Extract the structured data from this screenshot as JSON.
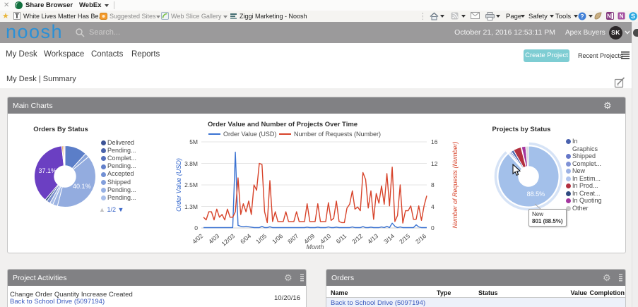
{
  "browser": {
    "webex_bar": {
      "close_icon": "close-icon",
      "share_label": "Share Browser",
      "menu_label": "WebEx"
    },
    "favorites": [
      {
        "icon": "page-favicon",
        "label": "White Lives Matter Has Be..."
      },
      {
        "icon": "suggested-sites-icon",
        "label": "Suggested Sites",
        "dropdown": true
      },
      {
        "icon": "web-slice-icon",
        "label": "Web Slice Gallery",
        "dropdown": true
      },
      {
        "icon": "noosh-favicon",
        "label": "Ziggi Marketing - Noosh"
      }
    ],
    "commands": [
      {
        "icon": "home-icon",
        "dropdown": true
      },
      {
        "icon": "feeds-icon",
        "dropdown": true
      },
      {
        "icon": "mail-icon"
      },
      {
        "icon": "print-icon",
        "dropdown": true
      },
      {
        "label": "Page",
        "dropdown": true
      },
      {
        "label": "Safety",
        "dropdown": true
      },
      {
        "label": "Tools",
        "dropdown": true
      },
      {
        "icon": "help-icon",
        "dropdown": true
      },
      {
        "icon": "notes-app-icon"
      },
      {
        "icon": "onenote-icon"
      },
      {
        "icon": "send-to-onenote-icon"
      },
      {
        "icon": "skype-icon"
      }
    ]
  },
  "header": {
    "logo": "noosh",
    "search_placeholder": "Search...",
    "datetime": "October 21, 2016 12:53:11 PM",
    "account": "Apex Buyers",
    "avatar_initials": "SK"
  },
  "nav": {
    "items": [
      "My Desk",
      "Workspace",
      "Contacts",
      "Reports"
    ],
    "create_button": "Create Project",
    "recent_label": "Recent Projects"
  },
  "breadcrumb": "My Desk | Summary",
  "panels": {
    "main": {
      "title": "Main Charts"
    },
    "activities": {
      "title": "Project Activities",
      "rows": [
        {
          "text": "Change Order Quantity Increase Created",
          "link": "Back to School Drive (5097194)",
          "date": "10/20/16"
        }
      ]
    },
    "orders": {
      "title": "Orders",
      "columns": [
        "Name",
        "Type",
        "Status",
        "Value",
        "Completion"
      ],
      "rows": [
        {
          "name": "Back to School Drive (5097194)",
          "type": "",
          "status": "",
          "value": "",
          "completion": ""
        }
      ]
    }
  },
  "chart_data": [
    {
      "type": "pie",
      "title": "Orders By Status",
      "pie_hole": 0.35,
      "slices": [
        {
          "label": "slice",
          "pct": 11.7,
          "color": "#5b7ec8"
        },
        {
          "label": "slice",
          "pct": 2.2,
          "color": "#8aa5db"
        },
        {
          "label": "slice",
          "pct": 40.1,
          "color": "#93acdf",
          "pct_label": "40.1%"
        },
        {
          "label": "slice",
          "pct": 2.5,
          "color": "#9db4e2"
        },
        {
          "label": "slice",
          "pct": 1.7,
          "color": "#a9bde6"
        },
        {
          "label": "slice",
          "pct": 1.9,
          "color": "#7a90cc"
        },
        {
          "label": "slice",
          "pct": 1.1,
          "color": "#2e4a80"
        },
        {
          "label": "slice",
          "pct": 37.1,
          "color": "#6b3fc2",
          "pct_label": "37.1%"
        },
        {
          "label": "slice",
          "pct": 0.7,
          "color": "#e0a33f"
        },
        {
          "label": "slice",
          "pct": 0.6,
          "color": "#c24040"
        },
        {
          "label": "slice",
          "pct": 0.4,
          "color": "#4a67b0"
        }
      ],
      "legend": {
        "items": [
          {
            "label": "Delivered",
            "color": "#3d5496"
          },
          {
            "label": "Pending...",
            "color": "#4a63ab"
          },
          {
            "label": "Complet...",
            "color": "#5570bc"
          },
          {
            "label": "Pending...",
            "color": "#6380ca"
          },
          {
            "label": "Accepted",
            "color": "#7290d4"
          },
          {
            "label": "Shipped",
            "color": "#84a0dc"
          },
          {
            "label": "Pending...",
            "color": "#97b1e4"
          },
          {
            "label": "Pending...",
            "color": "#a9bfea"
          }
        ],
        "pager": "1/2"
      }
    },
    {
      "type": "line",
      "title": "Order Value and Number of Projects Over Time",
      "xlabel": "Month",
      "x_ticks": [
        "4/02",
        "4/03",
        "12/03",
        "6/04",
        "1/05",
        "1/06",
        "8/07",
        "4/09",
        "4/10",
        "6/11",
        "2/12",
        "4/13",
        "3/14",
        "2/15",
        "2/16"
      ],
      "tick_every": 6,
      "left_axis": {
        "title": "Order Value (USD)",
        "color": "#3366cc",
        "ticks": [
          "0",
          "1.3M",
          "2.5M",
          "3.8M",
          "5M"
        ],
        "max": 5
      },
      "right_axis": {
        "title": "Number of Requests (Number)",
        "color": "#d7432a",
        "ticks": [
          "0",
          "4",
          "8",
          "12",
          "16"
        ],
        "max": 16
      },
      "series": [
        {
          "name": "Order Value (USD)",
          "color": "#3b73d2",
          "axis": "left",
          "values": [
            0.02,
            0.02,
            0.02,
            0.02,
            0.02,
            0.02,
            0.02,
            0.02,
            0.02,
            0.02,
            0.02,
            0.02,
            4.4,
            0.15,
            0.1,
            0.07,
            0.1,
            0.07,
            0.05,
            0.02,
            0.02,
            0.02,
            0.1,
            0.02,
            0.02,
            0.07,
            0.02,
            0.02,
            0.02,
            0.02,
            0.02,
            0.02,
            0.02,
            0.02,
            0.02,
            0.02,
            0.02,
            0.02,
            0.02,
            0.05,
            0.02,
            0.02,
            0.02,
            0.05,
            0.02,
            0.02,
            0.02,
            0.06,
            0.02,
            0.02,
            0.05,
            0.02,
            0.02,
            0.02,
            0.02,
            0.02,
            0.06,
            0.02,
            0.02,
            0.02,
            0.08,
            0.02,
            0.02,
            0.05,
            0.02,
            0.02,
            0.02,
            0.06,
            0.02,
            0.1,
            0.02,
            0.28,
            0.1,
            0.02,
            0.06,
            0.02,
            0.02,
            0.02,
            0.02,
            0.02,
            0.18,
            0.06,
            0.02,
            0.02,
            0.02
          ]
        },
        {
          "name": "Number of Requests (Number)",
          "color": "#d7432a",
          "axis": "right",
          "values": [
            2,
            1.5,
            3,
            3,
            1.5,
            3.5,
            2,
            2.5,
            1.5,
            3.5,
            2,
            2,
            3,
            9.3,
            2.5,
            4.5,
            3,
            5,
            2.5,
            8,
            7,
            12,
            11.8,
            3,
            1,
            8.8,
            1.2,
            3,
            1.2,
            1.2,
            1.2,
            3,
            1.2,
            1.2,
            1.2,
            3,
            1.2,
            1.2,
            1.2,
            4.5,
            1.2,
            1.2,
            1.2,
            4.5,
            1.2,
            1.2,
            1.2,
            4.7,
            1.4,
            1.8,
            5,
            1.2,
            1,
            1,
            3.7,
            4.4,
            6.9,
            3.5,
            3.9,
            3.2,
            10.3,
            9,
            3.7,
            6.9,
            1.6,
            6.4,
            4.6,
            7.8,
            4.4,
            10.1,
            4.1,
            11.3,
            1.2,
            2.3,
            8,
            0.9,
            3.2,
            3.2,
            4.1,
            1.6,
            1.6,
            4.1,
            1.4,
            4.1,
            6
          ]
        }
      ]
    },
    {
      "type": "pie",
      "title": "Projects by Status",
      "pie_hole": 0.33,
      "slices": [
        {
          "label": "New",
          "pct": 88.5,
          "color": "#a3c0ea",
          "pct_label": "88.5%",
          "highlighted": true
        },
        {
          "label": "In Estim...",
          "pct": 0.5,
          "color": "#9fb4e6"
        },
        {
          "label": "Complet...",
          "pct": 0.6,
          "color": "#8396d8"
        },
        {
          "label": "Shipped",
          "pct": 0.8,
          "color": "#6b7fd0"
        },
        {
          "label": "In Graphics",
          "pct": 1.4,
          "color": "#4a67b0"
        },
        {
          "label": "In Prod...",
          "pct": 4.2,
          "color": "#b22f3f"
        },
        {
          "label": "In Creat...",
          "pct": 0.3,
          "color": "#2f4a80"
        },
        {
          "label": "In Quoting",
          "pct": 2.2,
          "color": "#a4369f"
        },
        {
          "label": "Other",
          "pct": 1.5,
          "color": "#dcdcdc"
        }
      ],
      "legend": {
        "items": [
          {
            "label": "In Graphics",
            "lines": [
              "In",
              "Graphics"
            ],
            "color": "#4a62ae"
          },
          {
            "label": "Shipped",
            "color": "#6577c8"
          },
          {
            "label": "Complet...",
            "color": "#7f92d6"
          },
          {
            "label": "New",
            "color": "#9cb2e4"
          },
          {
            "label": "In Estim...",
            "color": "#afc4ee"
          },
          {
            "label": "In Prod...",
            "color": "#b22f3f"
          },
          {
            "label": "In Creat...",
            "color": "#2f4a80"
          },
          {
            "label": "In Quoting",
            "color": "#a4369f"
          },
          {
            "label": "Other",
            "color": "#c9c9c9"
          }
        ]
      },
      "tooltip": {
        "line1": "New",
        "line2": "801 (88.5%)"
      }
    }
  ]
}
